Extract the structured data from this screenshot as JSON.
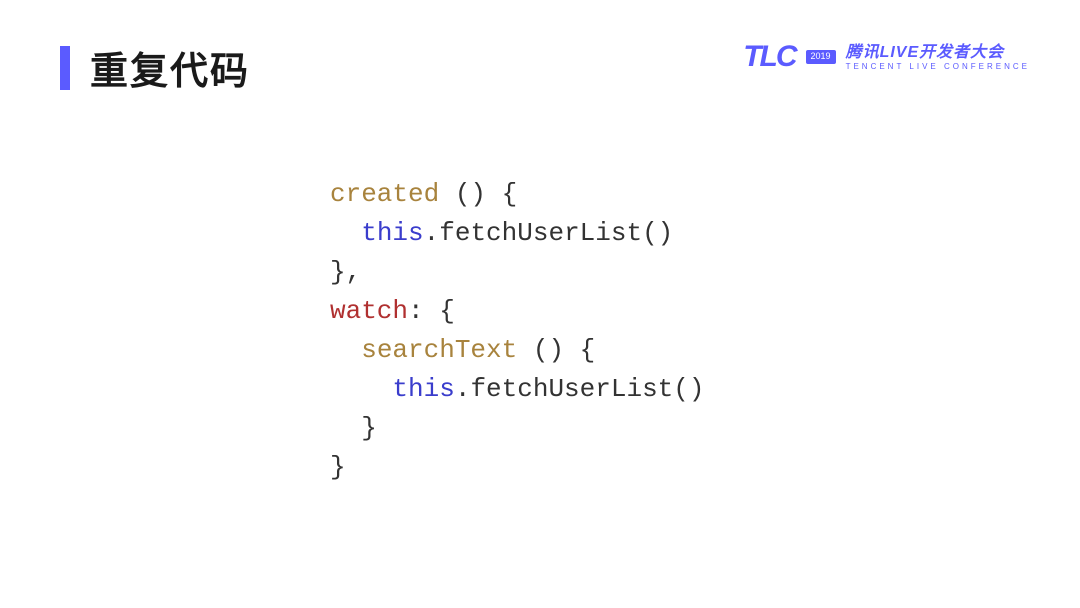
{
  "header": {
    "title": "重复代码",
    "logo": {
      "brand": "TLC",
      "year": "2019",
      "conf_main": "腾讯LIVE开发者大会",
      "conf_sub": "TENCENT LIVE CONFERENCE"
    }
  },
  "code": {
    "tokens": {
      "t0": "created",
      "t1": " () {",
      "t2": "  ",
      "t3": "this",
      "t4": ".fetchUserList()",
      "t5": "},",
      "t6": "watch",
      "t7": ": {",
      "t8": "  ",
      "t9": "searchText",
      "t10": " () {",
      "t11": "    ",
      "t12": "this",
      "t13": ".fetchUserList()",
      "t14": "  }",
      "t15": "}"
    }
  }
}
